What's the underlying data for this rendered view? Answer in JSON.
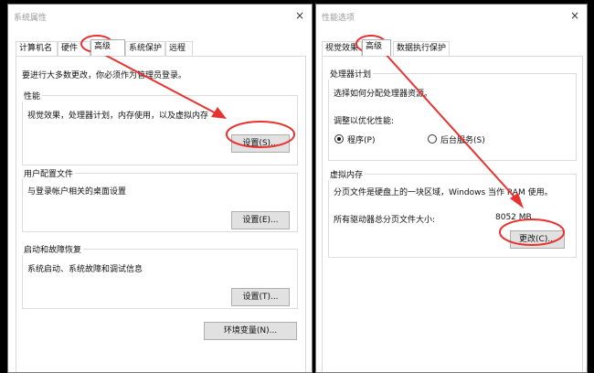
{
  "left_window": {
    "title": "系统属性",
    "close_symbol": "×",
    "tabs": [
      "计算机名",
      "硬件",
      "高级",
      "系统保护",
      "远程"
    ],
    "selected_tab": "高级",
    "admin_note": "要进行大多数更改，你必须作为管理员登录。",
    "performance": {
      "title": "性能",
      "desc": "视觉效果，处理器计划，内存使用，以及虚拟内存",
      "button": "设置(S)..."
    },
    "user_profiles": {
      "title": "用户配置文件",
      "desc": "与登录帐户相关的桌面设置",
      "button": "设置(E)..."
    },
    "startup_recovery": {
      "title": "启动和故障恢复",
      "desc": "系统启动、系统故障和调试信息",
      "button": "设置(T)..."
    },
    "env_button": "环境变量(N)..."
  },
  "right_window": {
    "title": "性能选项",
    "close_symbol": "×",
    "tabs": [
      "视觉效果",
      "高级",
      "数据执行保护"
    ],
    "selected_tab": "高级",
    "processor": {
      "title": "处理器计划",
      "desc": "选择如何分配处理器资源。",
      "adjust_label": "调整以优化性能:",
      "option_programs": "程序(P)",
      "option_services": "后台服务(S)",
      "selected": "程序(P)"
    },
    "virtual_memory": {
      "title": "虚拟内存",
      "desc": "分页文件是硬盘上的一块区域，Windows 当作 RAM 使用。",
      "total_label": "所有驱动器总分页文件大小:",
      "total_value": "8052 MB",
      "change_button": "更改(C)..."
    }
  },
  "colors": {
    "annotation_red": "#e8322f"
  }
}
